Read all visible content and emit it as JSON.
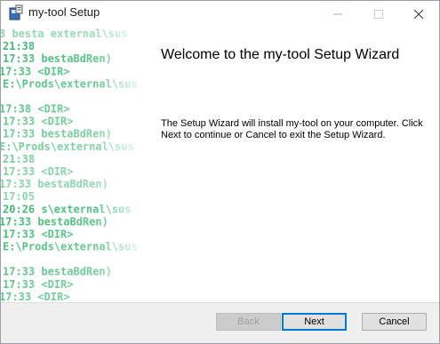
{
  "window": {
    "title": "my-tool Setup"
  },
  "banner": {
    "lines": [
      "  3  besta external\\sus",
      " 21:38",
      " 17:33 bestaBdRen)",
      " 17:33    <DIR>",
      "E:\\Prods\\external\\sus",
      "",
      " 17:38     <DIR>",
      " 17:33     <DIR>",
      " 17:33 bestaBdRen)",
      "E:\\Prods\\external\\sus",
      " 21:38",
      " 17:33     <DIR>",
      " 17:33 bestaBdRen)",
      " 17:05",
      " 20:26  s\\external\\sus",
      " 17:33 bestaBdRen)",
      " 17:33     <DIR>",
      "E:\\Prods\\external\\sus",
      "",
      " 17:33 bestaBdRen)",
      " 17:33     <DIR>",
      " 17:33     <DIR>"
    ]
  },
  "content": {
    "heading": "Welcome to the my-tool Setup Wizard",
    "body": "The Setup Wizard will install my-tool on your computer. Click Next to continue or Cancel to exit the Setup Wizard."
  },
  "buttons": {
    "back": "Back",
    "next": "Next",
    "cancel": "Cancel"
  },
  "icons": {
    "app": "installer-icon",
    "minimize": "minimize-icon",
    "maximize": "maximize-icon",
    "close": "close-icon"
  },
  "colors": {
    "banner_text": "#2fb56a",
    "accent": "#0078d7"
  }
}
